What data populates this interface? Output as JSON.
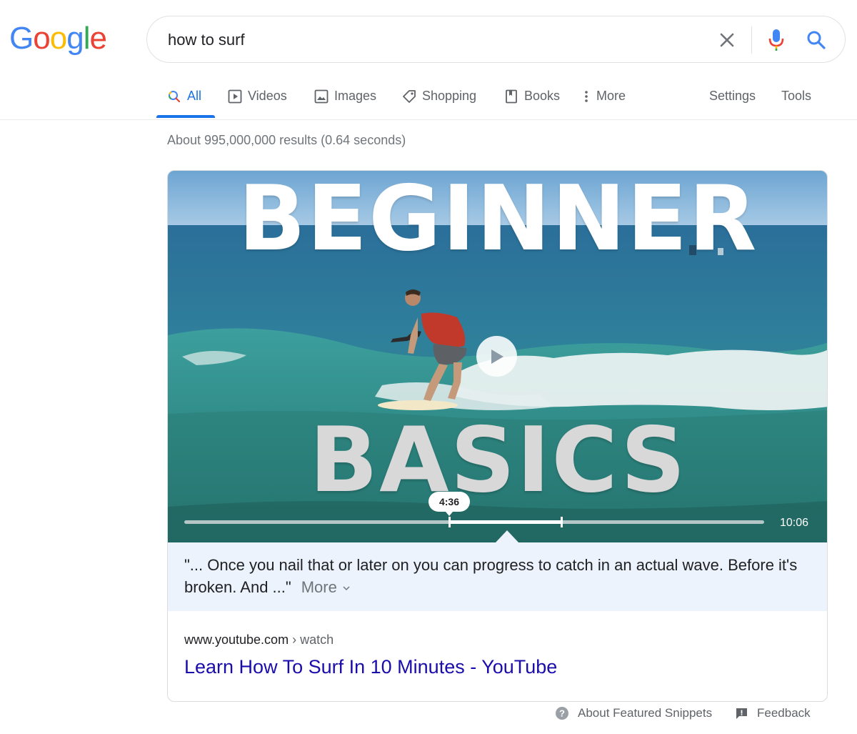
{
  "logo": {
    "letters": [
      "G",
      "o",
      "o",
      "g",
      "l",
      "e"
    ],
    "colors": [
      "#4285f4",
      "#ea4335",
      "#fbbc05",
      "#4285f4",
      "#34a853",
      "#ea4335"
    ]
  },
  "search": {
    "query": "how to surf",
    "icons": [
      "close-icon",
      "mic-icon",
      "search-icon"
    ]
  },
  "tabs": [
    {
      "label": "All",
      "icon": "search-icon",
      "active": true
    },
    {
      "label": "Videos",
      "icon": "video-icon"
    },
    {
      "label": "Images",
      "icon": "image-icon"
    },
    {
      "label": "Shopping",
      "icon": "tag-icon"
    },
    {
      "label": "Books",
      "icon": "book-icon"
    },
    {
      "label": "More",
      "icon": "more-vert-icon"
    },
    {
      "label": "Settings"
    },
    {
      "label": "Tools"
    }
  ],
  "result_stats": "About 995,000,000 results (0.64 seconds)",
  "video": {
    "overlay_top": "BEGINNER",
    "overlay_bottom": "BASICS",
    "current_time": "4:36",
    "duration": "10:06",
    "highlight_start": 0.457,
    "highlight_end": 0.65
  },
  "snippet": {
    "text": "\"... Once you nail that or later on you can progress to catch in an actual wave. Before it's broken. And ...\"",
    "more_label": "More"
  },
  "result": {
    "domain": "www.youtube.com",
    "path": " › watch",
    "title": "Learn How To Surf In 10 Minutes - YouTube"
  },
  "footer": {
    "about_label": "About Featured Snippets",
    "feedback_label": "Feedback"
  },
  "colors": {
    "accent": "#1a73e8",
    "link": "#1a0dab",
    "snippet_bg": "#edf3fc"
  }
}
